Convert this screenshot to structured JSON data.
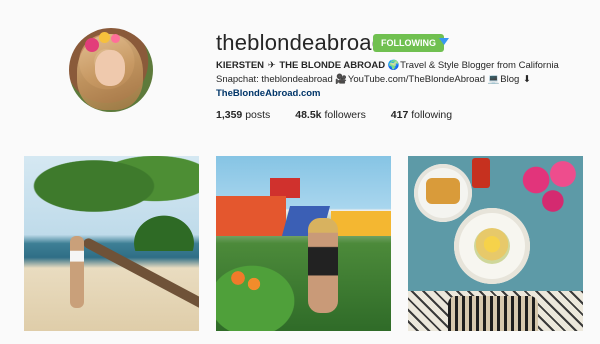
{
  "profile": {
    "username": "theblondeabroad",
    "follow_button": "FOLLOWING",
    "bio_line1_prefix": "KIERSTEN",
    "bio_line1_arrow": "✈",
    "bio_line1_name": "THE BLONDE ABROAD",
    "bio_line1_globe": "🌍",
    "bio_line1_text": "Travel & Style Blogger from California",
    "bio_line2_snap_label": "Snapchat: theblondeabroad",
    "bio_line2_camera": "🎥",
    "bio_line2_youtube": "YouTube.com/TheBlondeAbroad",
    "bio_line2_computer": "💻",
    "bio_line2_blog": "Blog",
    "bio_line2_down": "⬇",
    "website": "TheBlondeAbroad.com"
  },
  "stats": {
    "posts_count": "1,359",
    "posts_label": "posts",
    "followers_count": "48.5k",
    "followers_label": "followers",
    "following_count": "417",
    "following_label": "following"
  },
  "colors": {
    "follow_green": "#70c050",
    "dropdown_blue": "#3897f0",
    "link": "#003569"
  }
}
